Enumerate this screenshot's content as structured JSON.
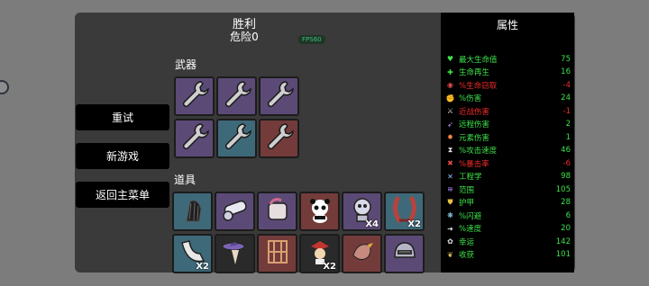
{
  "header": {
    "title": "胜利",
    "danger": "危险0",
    "fps": "FPS60"
  },
  "menu": {
    "retry": "重试",
    "new_game": "新游戏",
    "main_menu": "返回主菜单"
  },
  "weapons": {
    "label": "武器",
    "slots": [
      {
        "icon": "wrench-icon",
        "tier": "purple"
      },
      {
        "icon": "wrench-icon",
        "tier": "purple"
      },
      {
        "icon": "wrench-icon",
        "tier": "purple"
      },
      {
        "icon": "wrench-icon",
        "tier": "purple"
      },
      {
        "icon": "wrench-icon",
        "tier": "teal"
      },
      {
        "icon": "wrench-icon",
        "tier": "red"
      }
    ]
  },
  "items": {
    "label": "道具",
    "row1": [
      {
        "icon": "fin-icon",
        "tier": "teal",
        "qty": ""
      },
      {
        "icon": "cannon-icon",
        "tier": "purple",
        "qty": ""
      },
      {
        "icon": "barrel-icon",
        "tier": "purple",
        "qty": ""
      },
      {
        "icon": "panda-icon",
        "tier": "red",
        "qty": ""
      },
      {
        "icon": "robot-icon",
        "tier": "purple",
        "qty": "X4"
      },
      {
        "icon": "claw-icon",
        "tier": "teal",
        "qty": "X2"
      }
    ],
    "row2": [
      {
        "icon": "horn-icon",
        "tier": "teal",
        "qty": "X2"
      },
      {
        "icon": "hat-icon",
        "tier": "dark",
        "qty": ""
      },
      {
        "icon": "cage-icon",
        "tier": "red",
        "qty": ""
      },
      {
        "icon": "jester-icon",
        "tier": "dark",
        "qty": "X2"
      },
      {
        "icon": "bird-icon",
        "tier": "red",
        "qty": ""
      },
      {
        "icon": "helmet-icon",
        "tier": "purple",
        "qty": ""
      }
    ]
  },
  "stats": {
    "title": "属性",
    "colors": {
      "positive": "#3ee24a",
      "negative": "#f02a2a"
    },
    "rows": [
      {
        "icon": "heart-icon",
        "name": "最大生命值",
        "value": "75",
        "sign": "pos"
      },
      {
        "icon": "regen-icon",
        "name": "生命再生",
        "value": "16",
        "sign": "pos"
      },
      {
        "icon": "lifesteal-icon",
        "name": "%生命窃取",
        "value": "-4",
        "sign": "neg"
      },
      {
        "icon": "damage-icon",
        "name": "%伤害",
        "value": "24",
        "sign": "pos"
      },
      {
        "icon": "melee-icon",
        "name": "近战伤害",
        "value": "-1",
        "sign": "neg"
      },
      {
        "icon": "ranged-icon",
        "name": "远程伤害",
        "value": "2",
        "sign": "pos"
      },
      {
        "icon": "elemental-icon",
        "name": "元素伤害",
        "value": "1",
        "sign": "pos"
      },
      {
        "icon": "attack-speed-icon",
        "name": "%攻击速度",
        "value": "46",
        "sign": "pos"
      },
      {
        "icon": "crit-icon",
        "name": "%暴击率",
        "value": "-6",
        "sign": "neg"
      },
      {
        "icon": "engineering-icon",
        "name": "工程学",
        "value": "98",
        "sign": "pos"
      },
      {
        "icon": "range-icon",
        "name": "范围",
        "value": "105",
        "sign": "pos"
      },
      {
        "icon": "armor-icon",
        "name": "护甲",
        "value": "28",
        "sign": "pos"
      },
      {
        "icon": "dodge-icon",
        "name": "%闪避",
        "value": "6",
        "sign": "pos"
      },
      {
        "icon": "speed-icon",
        "name": "%速度",
        "value": "20",
        "sign": "pos"
      },
      {
        "icon": "luck-icon",
        "name": "幸运",
        "value": "142",
        "sign": "pos"
      },
      {
        "icon": "harvest-icon",
        "name": "收获",
        "value": "101",
        "sign": "pos"
      }
    ]
  }
}
